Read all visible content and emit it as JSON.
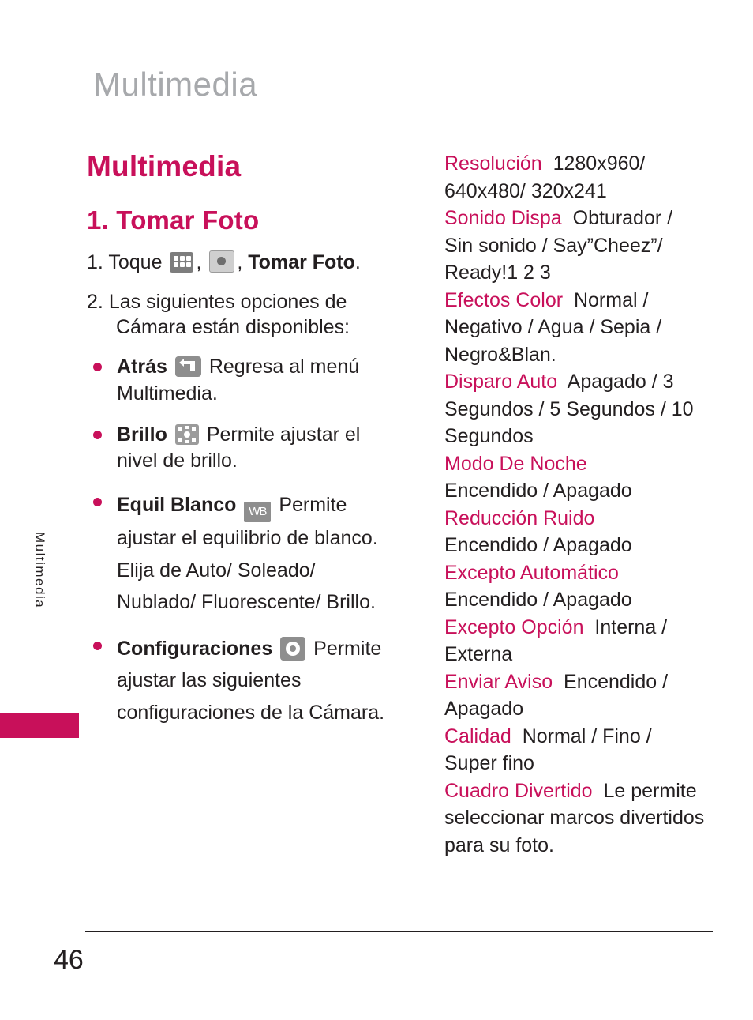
{
  "page": {
    "running_head": "Multimedia",
    "side_tab": "Multimedia",
    "page_number": "46",
    "accent_color": "#c8105a",
    "head_color": "#a7a9ac"
  },
  "left": {
    "title": "Multimedia",
    "section_title": "1. Tomar Foto",
    "step1": {
      "number": "1.",
      "text_a": "Toque",
      "comma_a": ",",
      "comma_b": ",",
      "bold_label": "Tomar Foto",
      "period": "."
    },
    "step2": {
      "number": "2.",
      "text": "Las siguientes opciones de Cámara están disponibles:"
    },
    "bullets": [
      {
        "label": "Atrás",
        "icon": "back-arrow-icon",
        "text": "Regresa al menú Multimedia."
      },
      {
        "label": "Brillo",
        "icon": "brightness-icon",
        "text": "Permite ajustar el nivel de brillo."
      },
      {
        "label": "Equil Blanco",
        "icon": "white-balance-icon",
        "icon_text": "WB",
        "text": "Permite ajustar el equilibrio de blanco. Elija de Auto/ Soleado/ Nublado/ Fluorescente/ Brillo."
      },
      {
        "label": "Configuraciones",
        "icon": "settings-gear-icon",
        "text": "Permite ajustar las siguientes configuraciones de la Cámara."
      }
    ]
  },
  "right": {
    "specs": [
      {
        "label": "Resolución",
        "value": "1280x960/ 640x480/ 320x241"
      },
      {
        "label": "Sonido Dispa",
        "value": "Obturador / Sin sonido / Say”Cheez”/ Ready!1 2 3"
      },
      {
        "label": "Efectos Color",
        "value": "Normal / Negativo / Agua / Sepia / Negro&Blan."
      },
      {
        "label": "Disparo Auto",
        "value": "Apagado / 3 Segundos / 5 Segundos / 10 Segundos"
      },
      {
        "label": "Modo De Noche",
        "value": "Encendido / Apagado"
      },
      {
        "label": "Reducción Ruido",
        "value": "Encendido / Apagado"
      },
      {
        "label": "Excepto Automático",
        "value": "Encendido / Apagado"
      },
      {
        "label": "Excepto Opción",
        "value": "Interna / Externa"
      },
      {
        "label": "Enviar Aviso",
        "value": "Encendido / Apagado"
      },
      {
        "label": "Calidad",
        "value": "Normal / Fino / Super fino"
      },
      {
        "label": "Cuadro Divertido",
        "value": "Le permite seleccionar marcos divertidos para su foto."
      }
    ]
  }
}
